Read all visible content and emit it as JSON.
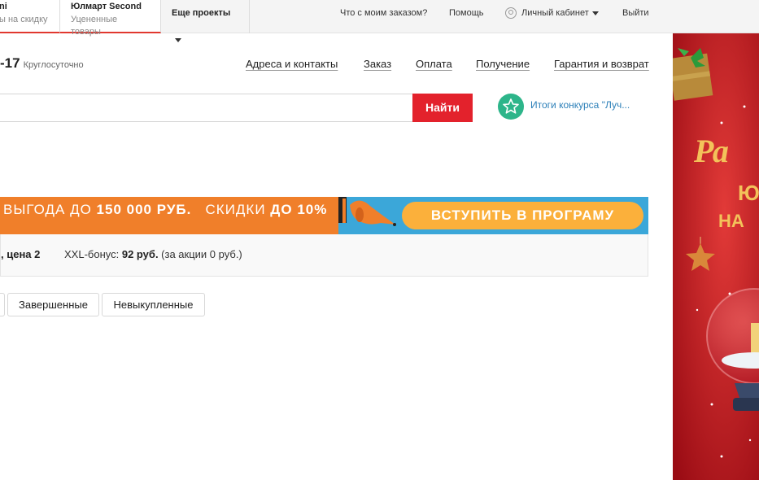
{
  "topbar": {
    "project1": {
      "title": "ni",
      "subtitle": "ы на скидку"
    },
    "project2": {
      "title": "Юлмарт Second",
      "subtitle": "Уцененные товары"
    },
    "more_projects": "Еще проекты",
    "order_status": "Что с моим заказом?",
    "help": "Помощь",
    "account": "Личный кабинет",
    "logout": "Выйти"
  },
  "header": {
    "phone": "-17",
    "phone_note": "Круглосуточно",
    "nav": [
      "Адреса и контакты",
      "Заказ",
      "Оплата",
      "Получение",
      "Гарантия и возврат"
    ]
  },
  "search": {
    "value": "",
    "button": "Найти",
    "contest_link": "Итоги конкурса \"Луч..."
  },
  "promo": {
    "text_light": "ВЫГОДА ДО ",
    "text_bold": "150 000 РУБ.",
    "text_light2": "   СКИДКИ ",
    "text_bold2": "ДО 10%",
    "cta": "ВСТУПИТЬ В ПРОГРАМУ",
    "colors": {
      "left": "#f07f2a",
      "right": "#3ba7d9",
      "cta": "#fbb03b"
    }
  },
  "info": {
    "price": ", цена 2",
    "bonus_label": "XXL-бонус: ",
    "bonus_value": "92 руб.",
    "bonus_note": " (за акции 0 руб.)"
  },
  "tabs": [
    "Завершенные",
    "Невыкупленные"
  ],
  "banner": {
    "line1": "Ра",
    "line2": "Ю",
    "line3": "НА"
  },
  "colors": {
    "accent_red": "#e3222c",
    "link_blue": "#2b7fb8",
    "green": "#2db58a"
  }
}
